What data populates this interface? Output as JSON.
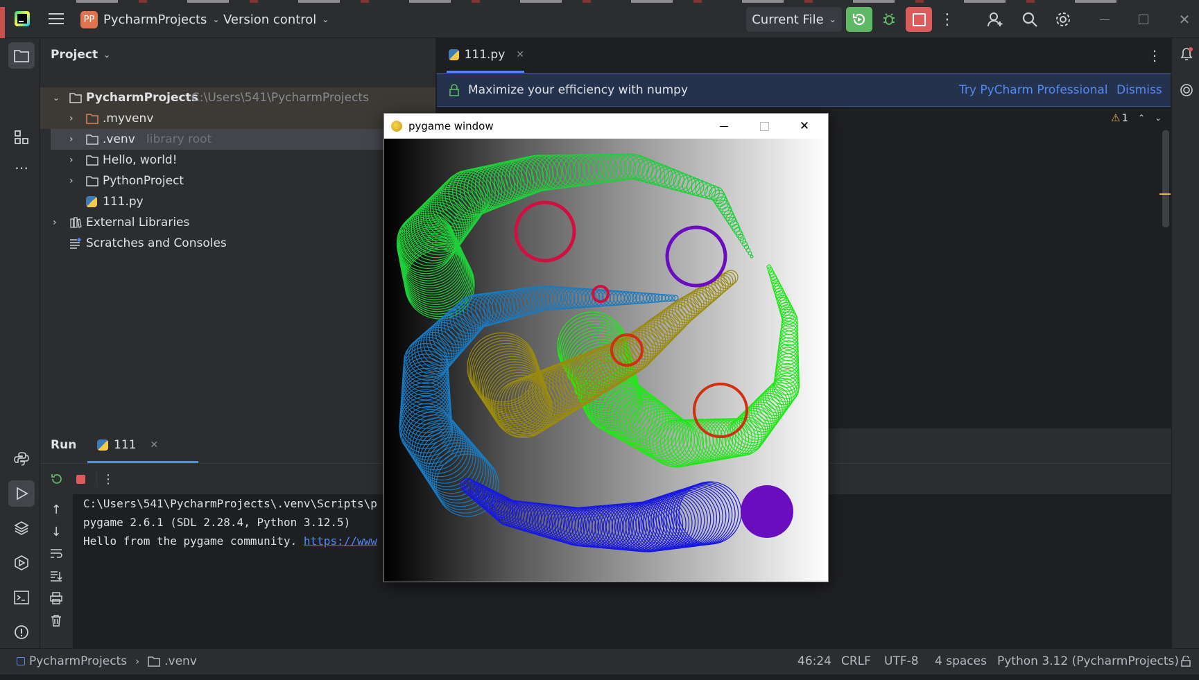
{
  "titlebar": {
    "project_badge": "PP",
    "project_name": "PycharmProjects",
    "vcs": "Version control",
    "run_config": "Current File"
  },
  "project_panel": {
    "title": "Project",
    "tree": [
      {
        "label": "PycharmProjects",
        "hint": "C:\\Users\\541\\PycharmProjects"
      },
      {
        "label": ".myvenv",
        "hint": ""
      },
      {
        "label": ".venv",
        "hint": "library root"
      },
      {
        "label": "Hello, world!",
        "hint": ""
      },
      {
        "label": "PythonProject",
        "hint": ""
      },
      {
        "label": "111.py",
        "hint": ""
      },
      {
        "label": "External Libraries",
        "hint": ""
      },
      {
        "label": "Scratches and Consoles",
        "hint": ""
      }
    ]
  },
  "editor": {
    "tab": "111.py",
    "banner_text": "Maximize your efficiency with numpy",
    "banner_action": "Try PyCharm Professional",
    "banner_dismiss": "Dismiss",
    "warnings": "1"
  },
  "run_panel": {
    "title": "Run",
    "tab": "111",
    "console": [
      "C:\\Users\\541\\PycharmProjects\\.venv\\Scripts\\p",
      "pygame 2.6.1 (SDL 2.28.4, Python 3.12.5)",
      "Hello from the pygame community. "
    ],
    "console_link": "https://www"
  },
  "pygame": {
    "title": "pygame window"
  },
  "statusbar": {
    "crumb1": "PycharmProjects",
    "crumb2": ".venv",
    "position": "46:24",
    "line_sep": "CRLF",
    "encoding": "UTF-8",
    "indent": "4 spaces",
    "interpreter": "Python 3.12 (PycharmProjects)"
  },
  "colors": {
    "accent_blue": "#548af7",
    "run_green": "#5fb865",
    "stop_red": "#db5c5c"
  }
}
